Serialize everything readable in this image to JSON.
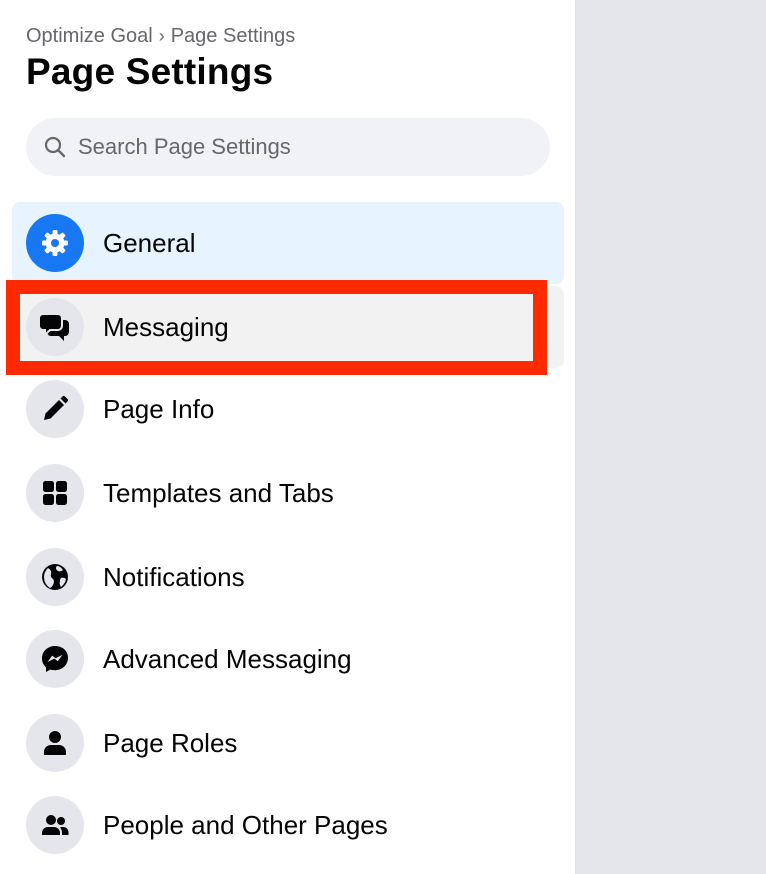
{
  "breadcrumb": {
    "parent": "Optimize Goal",
    "separator": "›",
    "current": "Page Settings"
  },
  "page_title": "Page Settings",
  "search": {
    "placeholder": "Search Page Settings",
    "value": ""
  },
  "menu": [
    {
      "label": "General",
      "icon": "gear-icon",
      "state": "selected"
    },
    {
      "label": "Messaging",
      "icon": "chat-bubbles-icon",
      "state": "highlighted"
    },
    {
      "label": "Page Info",
      "icon": "pencil-icon",
      "state": "default"
    },
    {
      "label": "Templates and Tabs",
      "icon": "grid-icon",
      "state": "default"
    },
    {
      "label": "Notifications",
      "icon": "globe-icon",
      "state": "default"
    },
    {
      "label": "Advanced Messaging",
      "icon": "messenger-icon",
      "state": "default"
    },
    {
      "label": "Page Roles",
      "icon": "person-icon",
      "state": "default"
    },
    {
      "label": "People and Other Pages",
      "icon": "people-icon",
      "state": "default"
    }
  ],
  "colors": {
    "accent": "#1877f2",
    "selected_bg": "#e7f3ff",
    "highlight_annotation": "#ff2a00",
    "icon_bg": "#e4e6eb",
    "secondary_text": "#65676b"
  }
}
